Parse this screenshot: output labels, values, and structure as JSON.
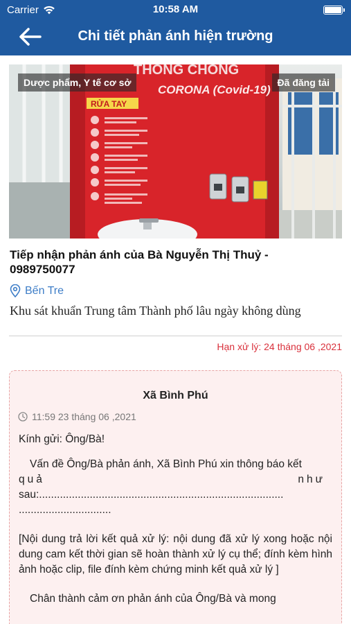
{
  "status_bar": {
    "carrier": "Carrier",
    "time": "10:58 AM"
  },
  "header": {
    "title": "Chi tiết phản ánh hiện trường"
  },
  "photo": {
    "category_badge": "Dược phẩm, Y tế cơ sở",
    "status_badge": "Đã đăng tải",
    "poster_headline": "THÔNG CHỐNG",
    "poster_corona": "CORONA (Covid-19)",
    "poster_rua_tay": "RỬA TAY"
  },
  "report": {
    "title": "Tiếp nhận phản ánh của Bà Nguyễn Thị Thuỷ - 0989750077",
    "location": "Bến Tre",
    "description": "Khu sát khuẩn Trung tâm Thành phố lâu ngày không dùng",
    "deadline": "Hạn xử lý: 24 tháng 06 ,2021"
  },
  "reply": {
    "unit": "Xã Bình Phú",
    "timestamp": "11:59 23 tháng 06 ,2021",
    "greeting": "Kính gửi: Ông/Bà!",
    "para1": "Vấn đề Ông/Bà phản ánh, Xã Bình Phú xin thông báo kết",
    "para1_word1": "quả",
    "para1_word2": "như",
    "para1_line3": "sau:..................................................................................",
    "para1_line4": "...............................",
    "para2": "[Nội dung trả lời kết quả xử lý: nội dung đã xử lý xong hoặc nội dung cam kết thời gian sẽ hoàn thành xử lý cụ thể; đính kèm hình ảnh hoặc clip, file đính kèm chứng minh kết quả xử lý ]",
    "para3": "Chân thành cảm ơn phản ánh của Ông/Bà và mong"
  },
  "colors": {
    "header_bg": "#1f5aa0",
    "link": "#3d7dc7",
    "deadline": "#d9303b",
    "reply_bg": "#fdf0f0"
  }
}
